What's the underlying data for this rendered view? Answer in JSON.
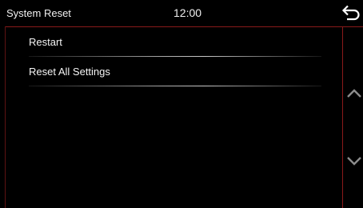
{
  "header": {
    "title": "System Reset",
    "time": "12:00"
  },
  "menu": {
    "items": [
      {
        "label": "Restart"
      },
      {
        "label": "Reset All Settings"
      }
    ]
  },
  "icons": {
    "back": "back-arrow-icon",
    "scroll_up": "chevron-up-icon",
    "scroll_down": "chevron-down-icon"
  },
  "colors": {
    "background": "#000000",
    "accent_line": "#8a1a1a",
    "text": "#f5f5f5",
    "icon": "#8c8c8c"
  }
}
